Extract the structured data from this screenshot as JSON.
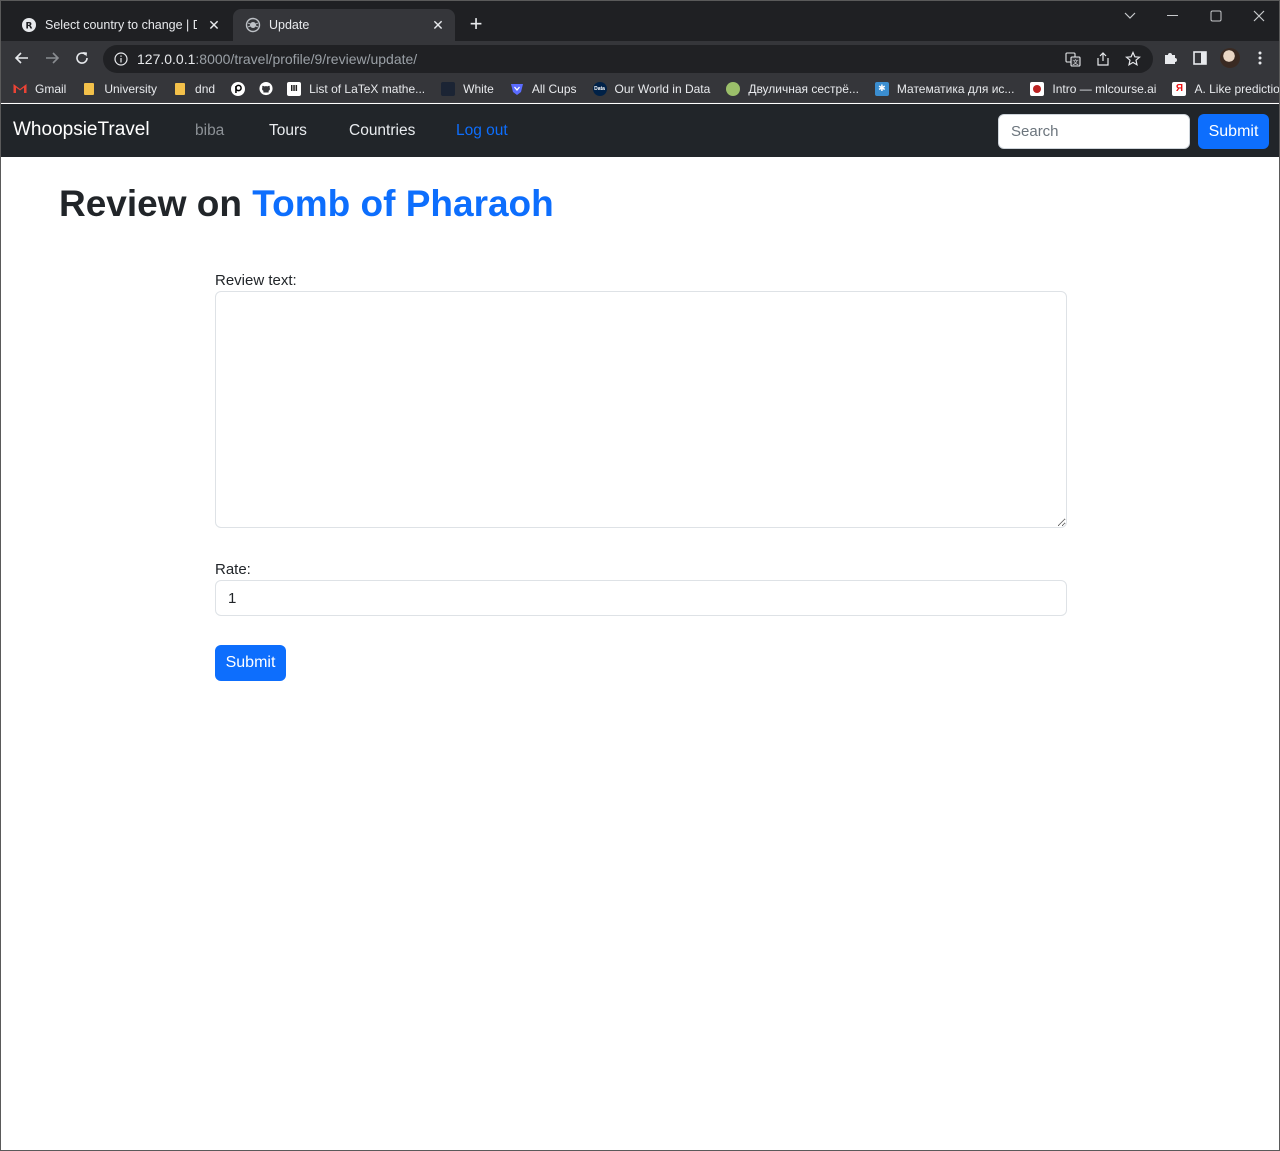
{
  "browser": {
    "tabs": [
      {
        "title": "Select country to change | Djang",
        "icon": "django-admin-icon"
      },
      {
        "title": "Update",
        "icon": "globe-icon"
      }
    ],
    "new_tab_label": "+",
    "address": {
      "host": "127.0.0.1",
      "path": ":8000/travel/profile/9/review/update/"
    },
    "bookmarks": [
      {
        "label": "Gmail",
        "icon": "gmail-icon",
        "color": "#ea4335"
      },
      {
        "label": "University",
        "icon": "folder-icon",
        "color": "#f3c14a"
      },
      {
        "label": "dnd",
        "icon": "folder-icon",
        "color": "#f3c14a"
      },
      {
        "label": "",
        "icon": "pixiv-icon",
        "color": "#ffffff"
      },
      {
        "label": "",
        "icon": "github-icon",
        "color": "#ffffff"
      },
      {
        "label": "List of LaTeX mathe...",
        "icon": "latex-icon",
        "color": "#ffffff"
      },
      {
        "label": "White",
        "icon": "white-icon",
        "color": "#1b2434"
      },
      {
        "label": "All Cups",
        "icon": "allcups-icon",
        "color": "#5b6cff"
      },
      {
        "label": "Our World in Data",
        "icon": "owid-icon",
        "color": "#002147"
      },
      {
        "label": "Двуличная сестрё...",
        "icon": "novel-icon",
        "color": "#9bbf6a"
      },
      {
        "label": "Математика для ис...",
        "icon": "math-icon",
        "color": "#3b8ed0"
      },
      {
        "label": "Intro — mlcourse.ai",
        "icon": "mlcourse-icon",
        "color": "#ffffff"
      },
      {
        "label": "A. Like prediction...",
        "icon": "yandex-icon",
        "color": "#ffffff"
      }
    ]
  },
  "navbar": {
    "brand": "WhoopsieTravel",
    "links": {
      "user": "biba",
      "tours": "Tours",
      "countries": "Countries",
      "logout": "Log out"
    },
    "search_placeholder": "Search",
    "submit_label": "Submit"
  },
  "page": {
    "heading_prefix": "Review on",
    "tour_name": "Tomb of Pharaoh",
    "form": {
      "review_label": "Review text:",
      "review_value": "",
      "rate_label": "Rate:",
      "rate_value": "1",
      "submit_label": "Submit"
    }
  },
  "colors": {
    "primary": "#0d6efd",
    "navbar_bg": "#212529",
    "text": "#212529"
  }
}
